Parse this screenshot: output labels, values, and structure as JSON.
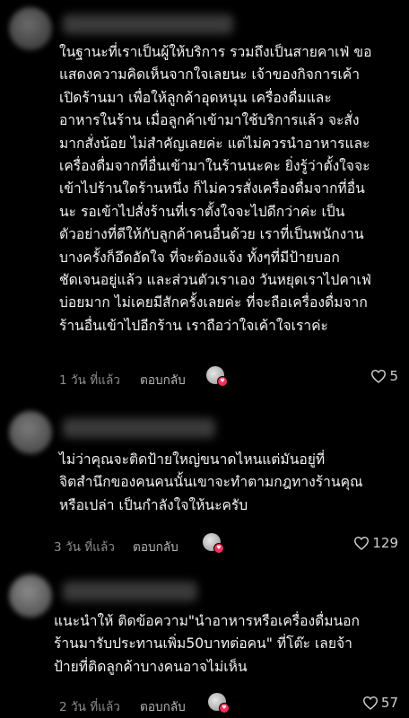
{
  "comments": [
    {
      "lines": [
        "ในฐานะที่เราเป็นผู้ให้บริการ รวมถึงเป็นสายคาเฟ่ ขอ",
        "แสดงความคิดเห็นจากใจเลยนะ เจ้าของกิจการเค้า",
        "เปิดร้านมา เพื่อให้ลูกค้าอุดหนุน เครื่องดื่มและ",
        "อาหารในร้าน เมื่อลูกค้าเข้ามาใช้บริการแล้ว จะสั่ง",
        "มากสั่งน้อย ไม่สำคัญเลยค่ะ แต่ไม่ควรนำอาหารและ",
        "เครื่องดื่มจากที่อื่นเข้ามาในร้านนะคะ ยิ่งรู้ว่าตั้งใจจะ",
        "เข้าไปร้านใดร้านหนึ่ง ก็ไม่ควรสั่งเครื่องดื่มจากที่อื่น",
        "นะ รอเข้าไปสั่งร้านที่เราตั้งใจจะไปดีกว่าค่ะ เป็น",
        "ตัวอย่างที่ดีให้กับลูกค้าคนอื่นด้วย เราที่เป็นพนักงาน",
        "บางครั้งก็อึดอัดใจ ที่จะต้องแจ้ง ทั้งๆที่มีป้ายบอก",
        "ชัดเจนอยู่แล้ว และส่วนตัวเราเอง วันหยุดเราไปคาเฟ่",
        "บ่อยมาก ไม่เคยมีสักครั้งเลยค่ะ ที่จะถือเครื่องดื่มจาก",
        "ร้านอื่นเข้าไปอีกร้าน เราถือว่าใจเค้าใจเราค่ะ"
      ],
      "time": "1 วัน ที่แล้ว",
      "reply": "ตอบกลับ",
      "likes": "5"
    },
    {
      "lines": [
        "ไม่ว่าคุณจะติดป้ายใหญ่ขนาดไหนแต่มันอยู่ที่",
        "จิตสำนึกของคนคนนั้นเขาจะทำตามกฎทางร้านคุณ",
        "หรือเปล่า เป็นกำลังใจให้นะครับ"
      ],
      "time": "3 วัน ที่แล้ว",
      "reply": "ตอบกลับ",
      "likes": "129"
    },
    {
      "lines": [
        "แนะนำให้ ติดข้อความ\"นำอาหารหรือเครื่องดื่มนอก",
        "ร้านมารับประทานเพิ่ม50บาทต่อคน\" ที่โต๊ะ เลยจ้า",
        "ป้ายที่ติดลูกค้าบางคนอาจไม่เห็น"
      ],
      "time": "2 วัน ที่แล้ว",
      "reply": "ตอบกลับ",
      "likes": "57"
    }
  ],
  "colors": {
    "background": "#000000",
    "text": "#f2f2f2",
    "meta": "#8e8e8e",
    "badge": "#fe2c55"
  },
  "icons": {
    "like": "heart-outline-icon",
    "author_badge": "heart-badge-icon"
  }
}
